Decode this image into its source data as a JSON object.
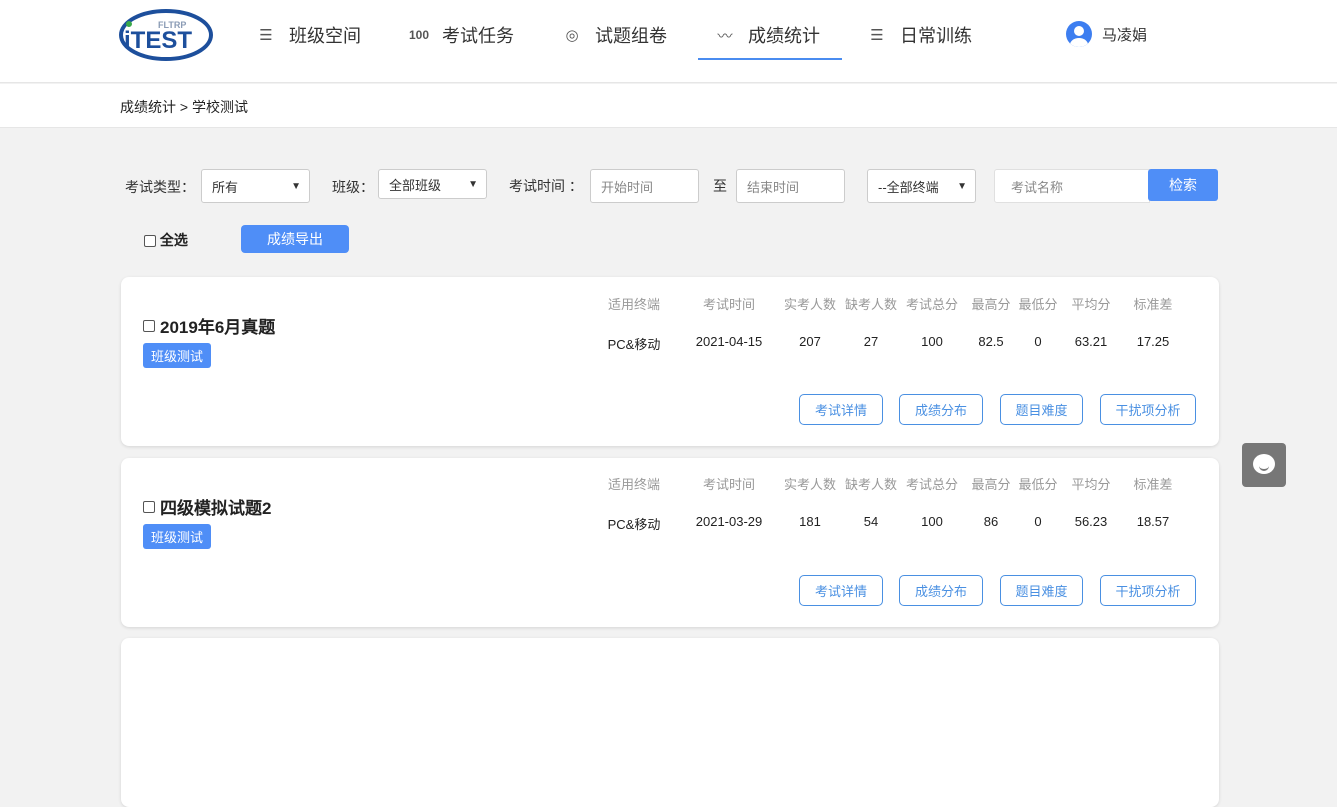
{
  "header": {
    "logo_text": "iTEST",
    "logo_sub": "FLTRP",
    "nav": [
      {
        "label": "班级空间",
        "icon": "menu-icon"
      },
      {
        "label": "考试任务",
        "icon": "hundred-icon"
      },
      {
        "label": "试题组卷",
        "icon": "circles-icon"
      },
      {
        "label": "成绩统计",
        "icon": "chart-line-icon",
        "active": true
      },
      {
        "label": "日常训练",
        "icon": "menu-icon"
      }
    ],
    "user": "马凌娟"
  },
  "breadcrumb": "成绩统计 > 学校测试",
  "filters": {
    "exam_type_label": "考试类型：",
    "exam_type_value": "所有",
    "class_label": "班级：",
    "class_value": "全部班级",
    "time_label": "考试时间 ：",
    "start_placeholder": "开始时间",
    "to": "至",
    "end_placeholder": "结束时间",
    "terminal_value": "--全部终端",
    "name_placeholder": "考试名称",
    "search": "检索"
  },
  "select_all": "全选",
  "export": "成绩导出",
  "columns": [
    "适用终端",
    "考试时间",
    "实考人数",
    "缺考人数",
    "考试总分",
    "最高分",
    "最低分",
    "平均分",
    "标准差"
  ],
  "actions": [
    "考试详情",
    "成绩分布",
    "题目难度",
    "干扰项分析"
  ],
  "exams": [
    {
      "title": "2019年6月真题",
      "tag": "班级测试",
      "values": [
        "PC&移动",
        "2021-04-15",
        "207",
        "27",
        "100",
        "82.5",
        "0",
        "63.21",
        "17.25"
      ]
    },
    {
      "title": "四级模拟试题2",
      "tag": "班级测试",
      "values": [
        "PC&移动",
        "2021-03-29",
        "181",
        "54",
        "100",
        "86",
        "0",
        "56.23",
        "18.57"
      ]
    }
  ]
}
